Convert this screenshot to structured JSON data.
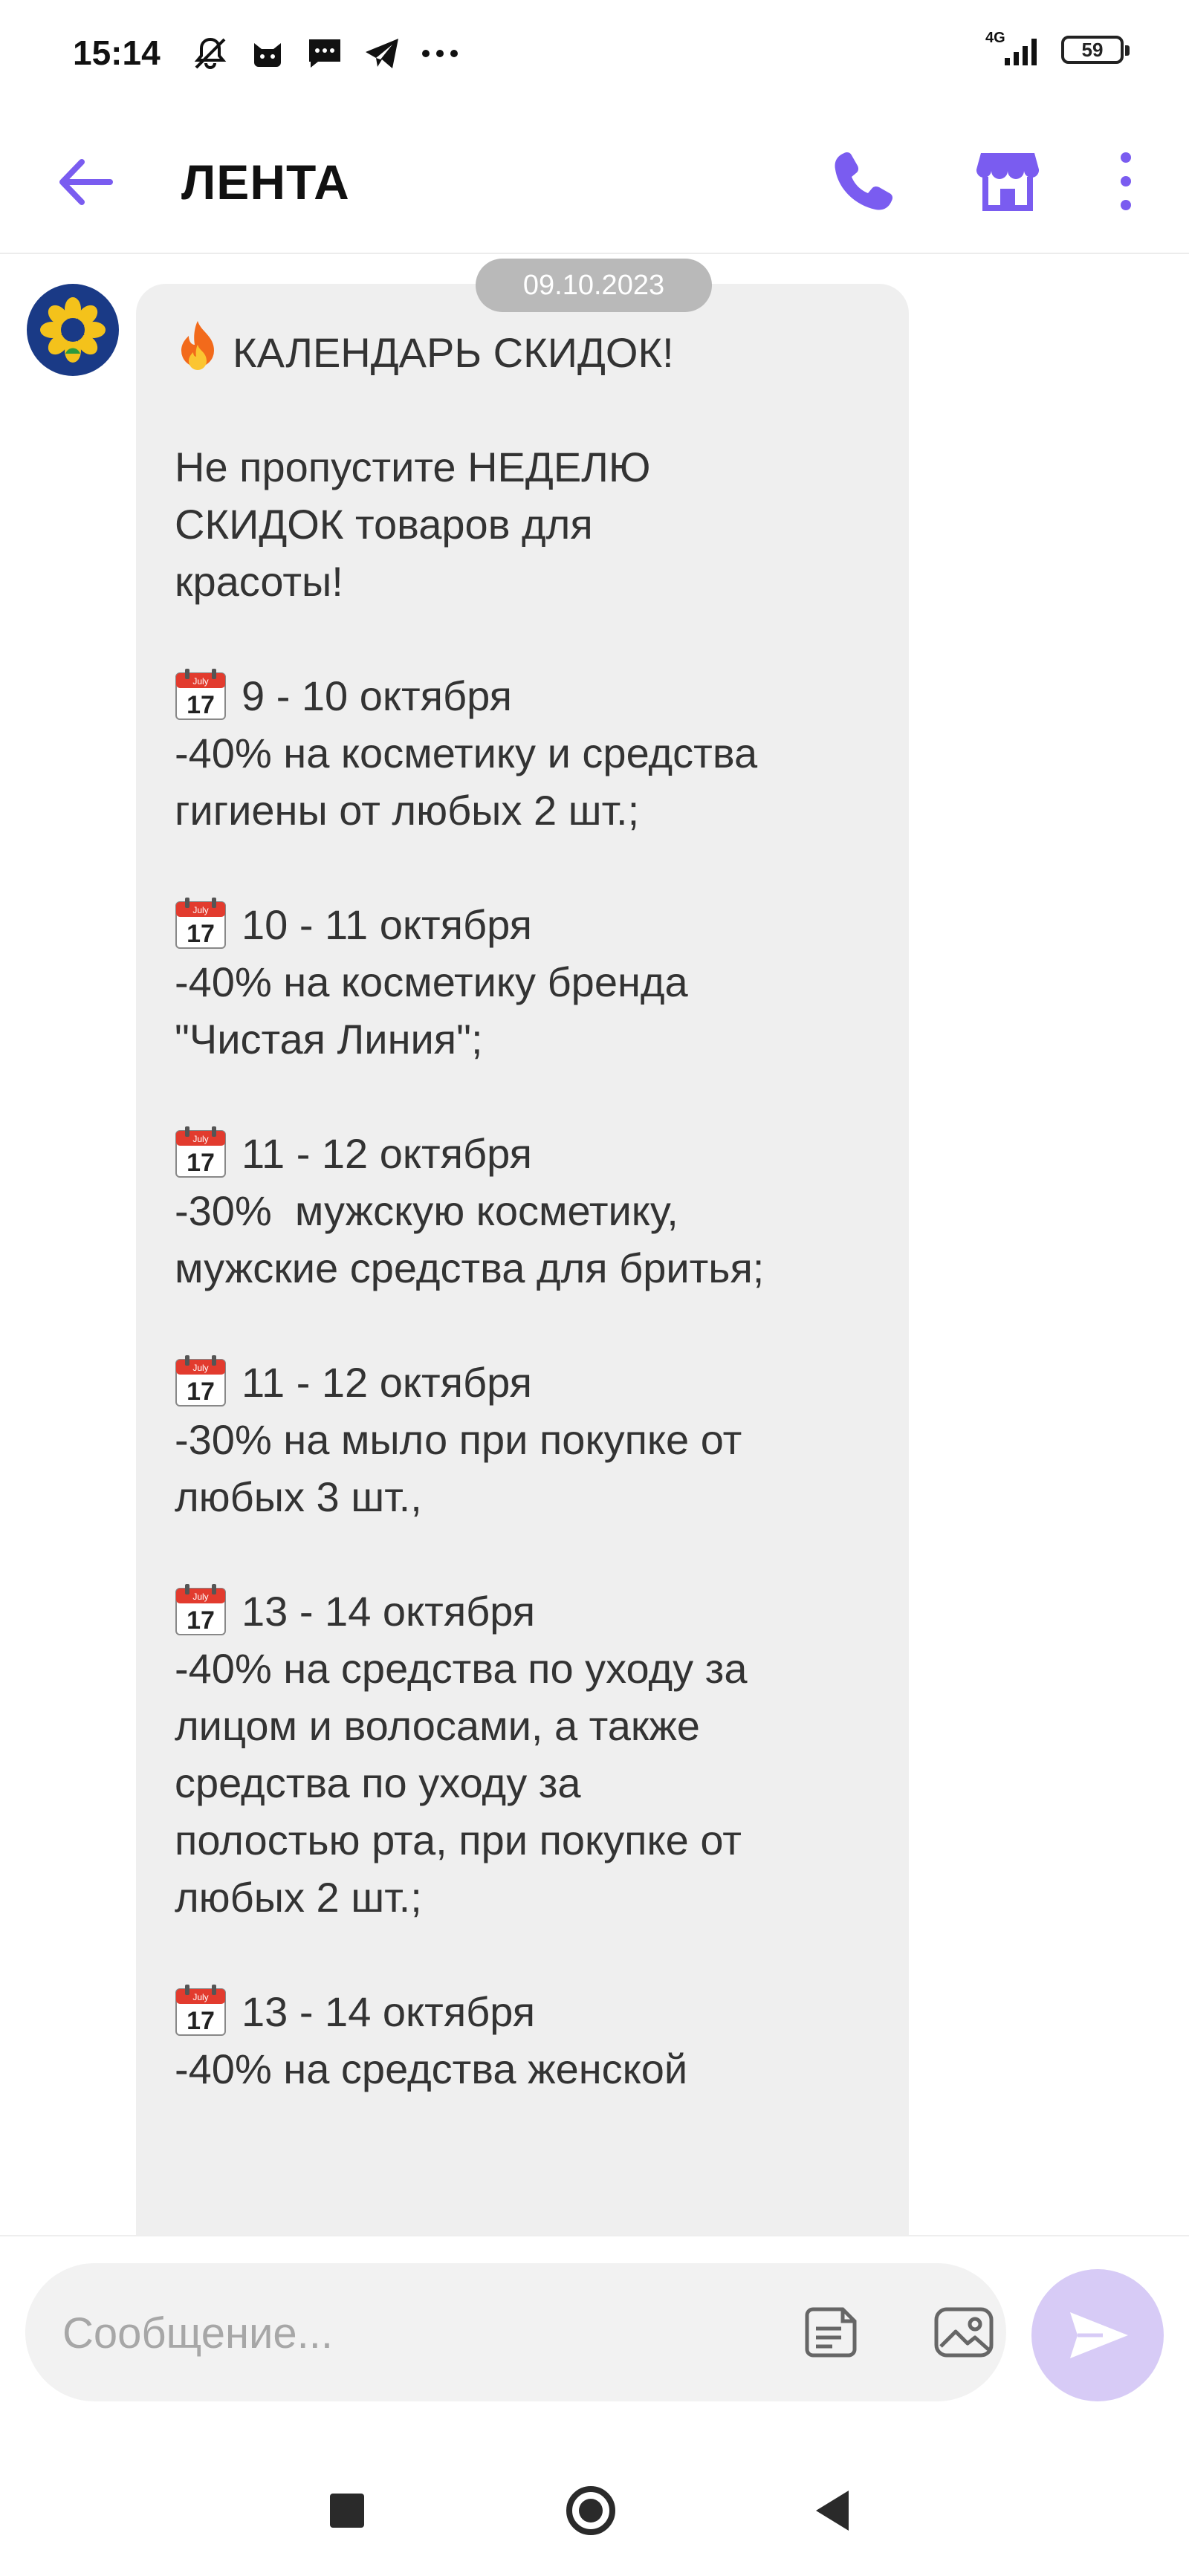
{
  "status_bar": {
    "time": "15:14",
    "network": "4G",
    "battery": "59",
    "icons": [
      "bell-off-icon",
      "cat-icon",
      "sms-icon",
      "telegram-icon",
      "more-dots-icon"
    ]
  },
  "header": {
    "title": "ЛЕНТА",
    "icons": [
      "back-arrow-icon",
      "phone-icon",
      "shop-icon",
      "kebab-menu-icon"
    ],
    "accent_color": "#7a5cf0"
  },
  "chat": {
    "date": "09.10.2023",
    "message": {
      "title": "КАЛЕНДАРЬ СКИДОК!",
      "intro": [
        "Не пропустите НЕДЕЛЮ",
        "СКИДОК товаров для",
        "красоты!"
      ],
      "items": [
        {
          "date": "9 - 10 октября",
          "lines": [
            "-40% на косметику и средства",
            "гигиены от любых 2 шт.;"
          ]
        },
        {
          "date": "10 - 11 октября",
          "lines": [
            "-40% на косметику бренда",
            "\"Чистая Линия\";"
          ]
        },
        {
          "date": "11 - 12 октября",
          "lines": [
            "-30%  мужскую косметику,",
            "мужские средства для бритья;"
          ]
        },
        {
          "date": "11 - 12 октября",
          "lines": [
            "-30% на мыло при покупке от",
            "любых 3 шт.,"
          ]
        },
        {
          "date": "13 - 14 октября",
          "lines": [
            "-40% на средства по уходу за",
            "лицом и волосами, а также",
            "средства по уходу за",
            "полостью рта, при покупке от",
            "любых 2 шт.;"
          ]
        },
        {
          "date": "13 - 14 октября",
          "lines": [
            "-40% на средства женской"
          ]
        }
      ],
      "calendar_icon_label": "July",
      "calendar_icon_day": "17"
    }
  },
  "input": {
    "placeholder": "Сообщение...",
    "icons": [
      "sticker-icon",
      "gallery-icon",
      "send-icon"
    ]
  },
  "nav": {
    "icons": [
      "recents-square-icon",
      "home-circle-icon",
      "back-triangle-icon"
    ]
  }
}
